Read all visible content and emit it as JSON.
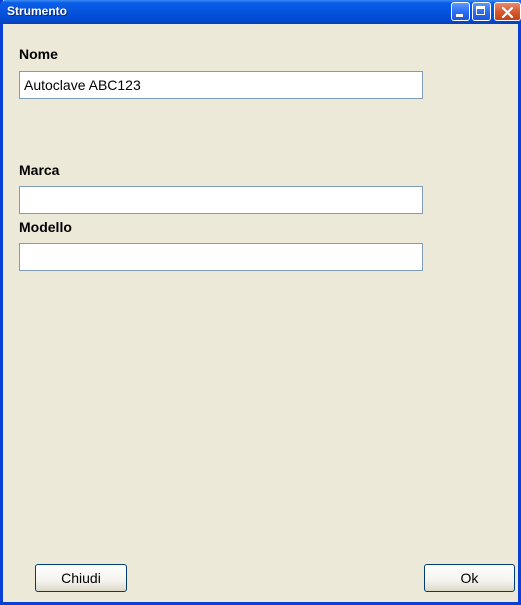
{
  "window": {
    "title": "Strumento"
  },
  "form": {
    "nome_label": "Nome",
    "nome_value": "Autoclave ABC123",
    "marca_label": "Marca",
    "marca_value": "",
    "modello_label": "Modello",
    "modello_value": ""
  },
  "buttons": {
    "close_label": "Chiudi",
    "ok_label": "Ok"
  },
  "icons": {
    "minimize": "minimize-icon",
    "maximize": "maximize-icon",
    "close": "close-icon"
  },
  "colors": {
    "titlebar": "#0553dd",
    "background": "#ece9d8",
    "close_button": "#d5582c"
  }
}
